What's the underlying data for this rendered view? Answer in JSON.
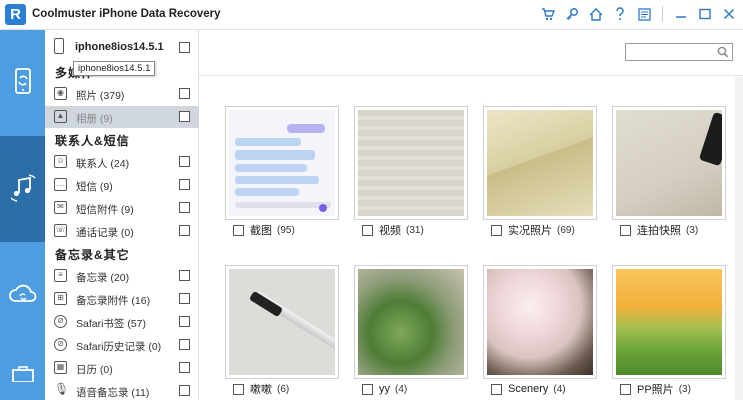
{
  "app": {
    "title": "Coolmuster iPhone Data Recovery",
    "logo_letter": "R"
  },
  "device": {
    "name": "iphone8ios14.5.1",
    "tooltip": "iphone8ios14.5.1"
  },
  "tree": {
    "sections": [
      {
        "label": "多媒体"
      },
      {
        "label": "联系人&短信"
      },
      {
        "label": "备忘录&其它"
      }
    ],
    "items": [
      {
        "label": "照片  (379)"
      },
      {
        "label": "相册  (9)"
      },
      {
        "label": "联系人  (24)"
      },
      {
        "label": "短信  (9)"
      },
      {
        "label": "短信附件  (9)"
      },
      {
        "label": "通话记录  (0)"
      },
      {
        "label": "备忘录  (20)"
      },
      {
        "label": "备忘录附件  (16)"
      },
      {
        "label": "Safari书签  (57)"
      },
      {
        "label": "Safari历史记录  (0)"
      },
      {
        "label": "日历  (0)"
      },
      {
        "label": "语音备忘录  (11)"
      }
    ]
  },
  "albums": [
    {
      "name": "截图",
      "count": "(95)"
    },
    {
      "name": "视频",
      "count": "(31)"
    },
    {
      "name": "实况照片",
      "count": "(69)"
    },
    {
      "name": "连拍快照",
      "count": "(3)"
    },
    {
      "name": "嗽嗽",
      "count": "(6)"
    },
    {
      "name": "yy",
      "count": "(4)"
    },
    {
      "name": "Scenery",
      "count": "(4)"
    },
    {
      "name": "PP照片",
      "count": "(3)"
    }
  ],
  "colors": {
    "accent": "#2b7ac8",
    "rail": "#4d9de0",
    "rail_active": "#2b6ea8",
    "selected_row": "#cfd6de"
  },
  "icons": {
    "toolbar": [
      "cart-icon",
      "key-icon",
      "home-icon",
      "help-icon",
      "feedback-icon",
      "minimize-icon",
      "maximize-icon",
      "close-icon"
    ],
    "rail": [
      "phone-sync-icon",
      "music-sync-icon",
      "cloud-sync-icon",
      "toolbox-icon"
    ]
  }
}
